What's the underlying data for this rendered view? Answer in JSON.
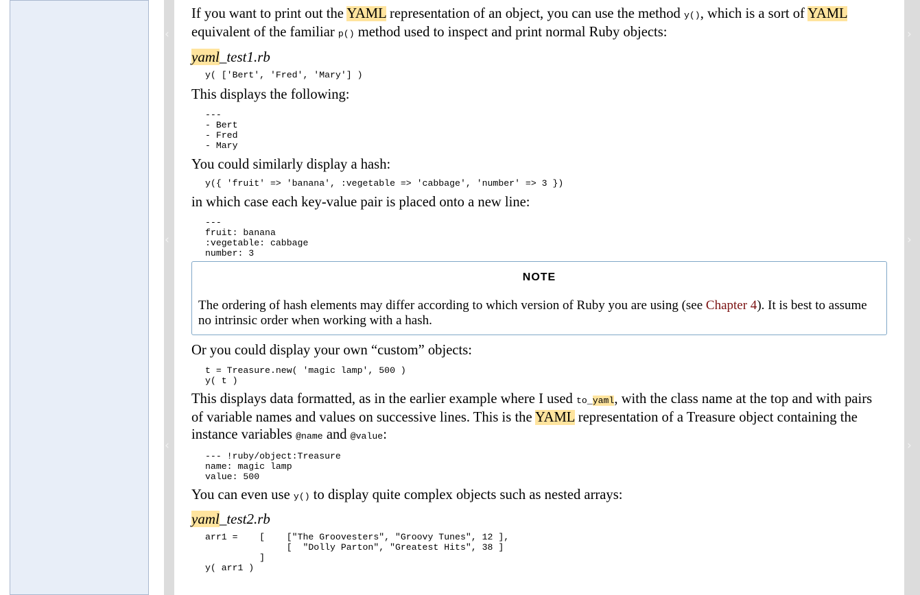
{
  "nav": {
    "prev_glyph": "‹",
    "next_glyph": "›"
  },
  "intro": {
    "t1": "If you want to print out the ",
    "yaml": "YAML",
    "t2": " representation of an object, you can use the method ",
    "code_y": "y()",
    "t3": ", which is a sort of ",
    "t4": "equivalent of the familiar ",
    "code_p": "p()",
    "t5": " method used to inspect and print normal Ruby objects:"
  },
  "file1": {
    "hl": "yaml",
    "rest": "_test1.rb"
  },
  "code1": "y( ['Bert', 'Fred', 'Mary'] )",
  "displays": "This displays the following:",
  "out1": "---\n- Bert\n- Fred\n- Mary",
  "hash_intro": "You could similarly display a hash:",
  "code2": "y({ 'fruit' => 'banana', :vegetable => 'cabbage', 'number' => 3 })",
  "hash_line": "in which case each key-value pair is placed onto a new line:",
  "out2": "---\nfruit: banana\n:vegetable: cabbage\nnumber: 3",
  "note": {
    "title": "NOTE",
    "t1": "The ordering of hash elements may differ according to which version of Ruby you are using (see ",
    "link": "Chapter 4",
    "t2": "). It is best to assume no intrinsic order when working with a hash."
  },
  "custom_intro": "Or you could display your own “custom” objects:",
  "code3": "t = Treasure.new( 'magic lamp', 500 )\ny( t )",
  "para2": {
    "t1": "This displays data formatted, as in the earlier example where I used ",
    "code_to": "to_",
    "code_yaml": "yaml",
    "t2": ", with the class name at the top and with pairs of variable names and values on successive lines. This is the ",
    "yaml": "YAML",
    "t3": " representation of a Treasure object containing the instance variables ",
    "code_name": "@name",
    "t4": " and ",
    "code_value": "@value",
    "t5": ":"
  },
  "out3": "--- !ruby/object:Treasure\nname: magic lamp\nvalue: 500",
  "complex": {
    "t1": "You can even use ",
    "code_y": "y()",
    "t2": " to display quite complex objects such as nested arrays:"
  },
  "file2": {
    "hl": "yaml",
    "rest": "_test2.rb"
  },
  "code4": "arr1 =    [    [\"The Groovesters\", \"Groovy Tunes\", 12 ],\n               [  \"Dolly Parton\", \"Greatest Hits\", 38 ]\n          ]\ny( arr1 )"
}
